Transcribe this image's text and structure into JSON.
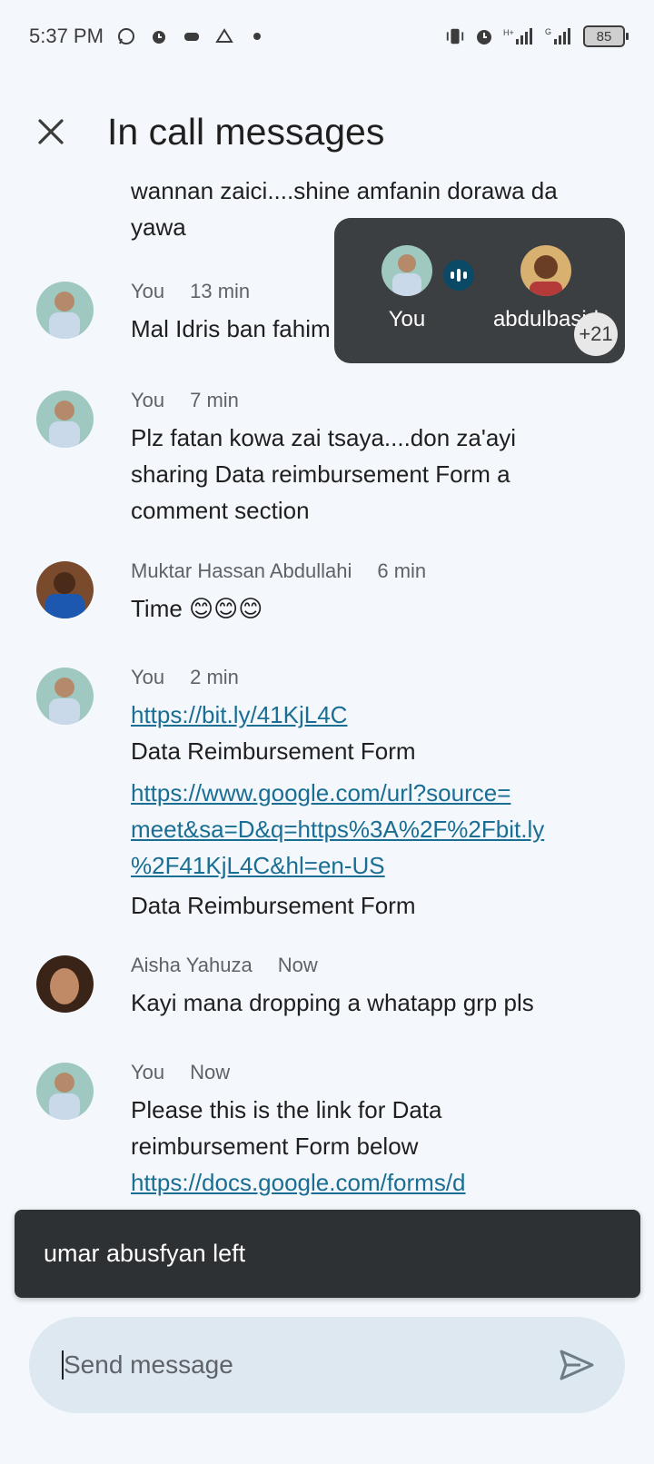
{
  "status_bar": {
    "time": "5:37 PM",
    "icons_left": [
      "whatsapp-icon",
      "alarm-icon",
      "gamepad-icon",
      "drive-icon",
      "dot-icon"
    ],
    "icons_right": [
      "vibrate-icon",
      "alarm-icon",
      "signal-h-plus-icon",
      "signal-g-icon"
    ],
    "network_primary": "H+",
    "network_secondary": "G",
    "battery": "85"
  },
  "header": {
    "title": "In call messages",
    "close_icon": "close-icon"
  },
  "messages": [
    {
      "sender": "",
      "time": "",
      "lines": [
        "wannan zaici....shine amfanin dorawa da",
        "yawa"
      ],
      "avatar": "none"
    },
    {
      "sender": "You",
      "time": "13 min",
      "lines": [
        "Mal Idris ban fahim"
      ],
      "avatar": "you"
    },
    {
      "sender": "You",
      "time": "7 min",
      "lines": [
        "Plz fatan kowa zai tsaya....don za'ayi",
        "sharing Data reimbursement Form a",
        "comment section"
      ],
      "avatar": "you"
    },
    {
      "sender": "Muktar Hassan Abdullahi",
      "time": "6 min",
      "lines": [
        "Time 😊😊😊"
      ],
      "avatar": "muktar"
    },
    {
      "sender": "You",
      "time": "2 min",
      "avatar": "you",
      "link1": "https://bit.ly/41KjL4C",
      "label1": "Data Reimbursement Form",
      "link2_lines": [
        "https://www.google.com/url?source=",
        "meet&sa=D&q=https%3A%2F%2Fbit.ly",
        "%2F41KjL4C&hl=en-US"
      ],
      "label2": "Data Reimbursement Form"
    },
    {
      "sender": "Aisha Yahuza",
      "time": "Now",
      "lines": [
        "Kayi mana dropping a whatapp grp pls"
      ],
      "avatar": "aisha"
    },
    {
      "sender": "You",
      "time": "Now",
      "lines": [
        "Please this is the link for Data",
        "reimbursement Form below"
      ],
      "partial_link": "https://docs.google.com/forms/d",
      "avatar": "you"
    }
  ],
  "participants": {
    "items": [
      {
        "name": "You",
        "speaking": true
      },
      {
        "name": "abdulbasid"
      }
    ],
    "more_count": "+21"
  },
  "snackbar": {
    "text": "umar abusfyan left"
  },
  "composer": {
    "placeholder": "Send message",
    "value": "",
    "send_icon": "send-icon"
  },
  "colors": {
    "background": "#f4f8fc",
    "link": "#1a6e93",
    "overlay": "#3b3f42",
    "snackbar": "#2e3133",
    "composer": "#dde8f0"
  }
}
